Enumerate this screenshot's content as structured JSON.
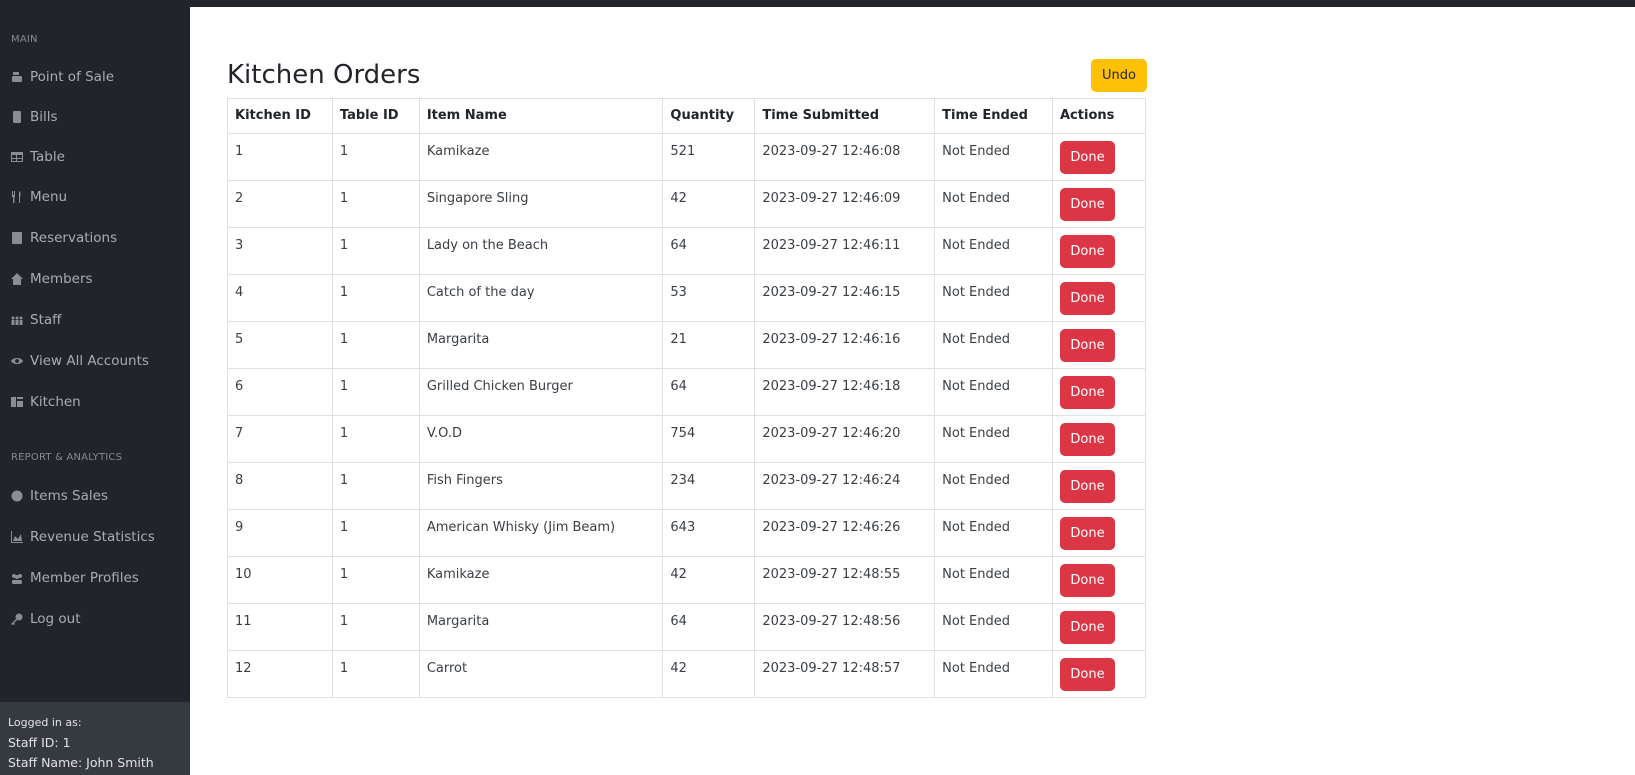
{
  "sidebar": {
    "main_heading": "MAIN",
    "main_items": [
      {
        "label": "Point of Sale",
        "icon": "cash-register-icon"
      },
      {
        "label": "Bills",
        "icon": "receipt-icon"
      },
      {
        "label": "Table",
        "icon": "table-icon"
      },
      {
        "label": "Menu",
        "icon": "utensils-icon"
      },
      {
        "label": "Reservations",
        "icon": "book-icon"
      },
      {
        "label": "Members",
        "icon": "home-user-icon"
      },
      {
        "label": "Staff",
        "icon": "people-icon"
      },
      {
        "label": "View All Accounts",
        "icon": "eye-icon"
      },
      {
        "label": "Kitchen",
        "icon": "kitchen-icon"
      }
    ],
    "report_heading": "REPORT & ANALYTICS",
    "report_items": [
      {
        "label": "Items Sales",
        "icon": "pie-chart-icon"
      },
      {
        "label": "Revenue Statistics",
        "icon": "area-chart-icon"
      },
      {
        "label": "Member Profiles",
        "icon": "users-icon"
      },
      {
        "label": "Log out",
        "icon": "key-icon"
      }
    ],
    "footer": {
      "logged_in_label": "Logged in as:",
      "staff_id": "Staff ID: 1",
      "staff_name": "Staff Name: John Smith"
    }
  },
  "main": {
    "title": "Kitchen Orders",
    "undo_label": "Undo",
    "columns": [
      "Kitchen ID",
      "Table ID",
      "Item Name",
      "Quantity",
      "Time Submitted",
      "Time Ended",
      "Actions"
    ],
    "rows": [
      {
        "kitchen_id": "1",
        "table_id": "1",
        "item": "Kamikaze",
        "qty": "521",
        "submitted": "2023-09-27 12:46:08",
        "ended": "Not Ended",
        "action": "Done"
      },
      {
        "kitchen_id": "2",
        "table_id": "1",
        "item": "Singapore Sling",
        "qty": "42",
        "submitted": "2023-09-27 12:46:09",
        "ended": "Not Ended",
        "action": "Done"
      },
      {
        "kitchen_id": "3",
        "table_id": "1",
        "item": "Lady on the Beach",
        "qty": "64",
        "submitted": "2023-09-27 12:46:11",
        "ended": "Not Ended",
        "action": "Done"
      },
      {
        "kitchen_id": "4",
        "table_id": "1",
        "item": "Catch of the day",
        "qty": "53",
        "submitted": "2023-09-27 12:46:15",
        "ended": "Not Ended",
        "action": "Done"
      },
      {
        "kitchen_id": "5",
        "table_id": "1",
        "item": "Margarita",
        "qty": "21",
        "submitted": "2023-09-27 12:46:16",
        "ended": "Not Ended",
        "action": "Done"
      },
      {
        "kitchen_id": "6",
        "table_id": "1",
        "item": "Grilled Chicken Burger",
        "qty": "64",
        "submitted": "2023-09-27 12:46:18",
        "ended": "Not Ended",
        "action": "Done"
      },
      {
        "kitchen_id": "7",
        "table_id": "1",
        "item": "V.O.D",
        "qty": "754",
        "submitted": "2023-09-27 12:46:20",
        "ended": "Not Ended",
        "action": "Done"
      },
      {
        "kitchen_id": "8",
        "table_id": "1",
        "item": "Fish Fingers",
        "qty": "234",
        "submitted": "2023-09-27 12:46:24",
        "ended": "Not Ended",
        "action": "Done"
      },
      {
        "kitchen_id": "9",
        "table_id": "1",
        "item": "American Whisky (Jim Beam)",
        "qty": "643",
        "submitted": "2023-09-27 12:46:26",
        "ended": "Not Ended",
        "action": "Done"
      },
      {
        "kitchen_id": "10",
        "table_id": "1",
        "item": "Kamikaze",
        "qty": "42",
        "submitted": "2023-09-27 12:48:55",
        "ended": "Not Ended",
        "action": "Done"
      },
      {
        "kitchen_id": "11",
        "table_id": "1",
        "item": "Margarita",
        "qty": "64",
        "submitted": "2023-09-27 12:48:56",
        "ended": "Not Ended",
        "action": "Done"
      },
      {
        "kitchen_id": "12",
        "table_id": "1",
        "item": "Carrot",
        "qty": "42",
        "submitted": "2023-09-27 12:48:57",
        "ended": "Not Ended",
        "action": "Done"
      }
    ]
  },
  "colors": {
    "sidebar_bg": "#212529",
    "sidebar_footer_bg": "#343a40",
    "undo_button": "#ffc107",
    "done_button": "#dc3545"
  }
}
